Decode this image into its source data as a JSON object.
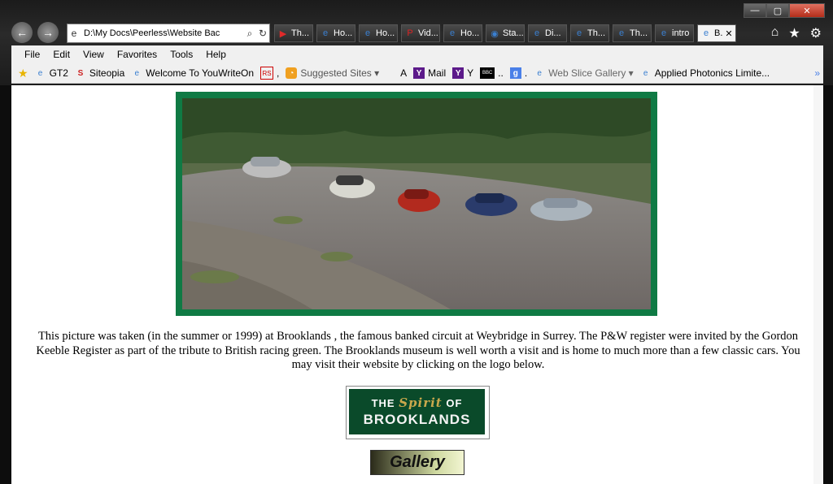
{
  "browser": {
    "address": "D:\\My Docs\\Peerless\\Website Bac",
    "tabs": [
      {
        "label": "Th...",
        "icon": "youtube-icon"
      },
      {
        "label": "Ho...",
        "icon": "ie-icon"
      },
      {
        "label": "Ho...",
        "icon": "ie-icon"
      },
      {
        "label": "Vid...",
        "icon": "p-icon"
      },
      {
        "label": "Ho...",
        "icon": "ie-icon"
      },
      {
        "label": "Sta...",
        "icon": "globe-icon"
      },
      {
        "label": "Di...",
        "icon": "ie-icon"
      },
      {
        "label": "Th...",
        "icon": "ie-icon"
      },
      {
        "label": "Th...",
        "icon": "ie-icon"
      },
      {
        "label": "intro",
        "icon": "ie-icon"
      },
      {
        "label": "B.",
        "icon": "ie-icon"
      }
    ],
    "menu": [
      "File",
      "Edit",
      "View",
      "Favorites",
      "Tools",
      "Help"
    ],
    "favorites": [
      {
        "label": "GT2",
        "icon": "ie-icon"
      },
      {
        "label": "Siteopia",
        "icon": "siteopia-icon"
      },
      {
        "label": "Welcome To YouWriteOn",
        "icon": "ie-icon"
      },
      {
        "label": ",",
        "icon": "rs-icon"
      },
      {
        "label": "Suggested Sites ▾",
        "icon": "suggested-sites-icon"
      },
      {
        "label": "A",
        "icon": "apple-icon"
      },
      {
        "label": "Mail",
        "icon": "yahoo-icon"
      },
      {
        "label": "Y",
        "icon": "yahoo-icon"
      },
      {
        "label": "..",
        "icon": "bbc-icon"
      },
      {
        "label": ".",
        "icon": "google-icon"
      },
      {
        "label": "Web Slice Gallery ▾",
        "icon": "web-slice-icon"
      },
      {
        "label": "Applied Photonics Limite...",
        "icon": "ie-icon"
      }
    ]
  },
  "page": {
    "caption": "This picture was taken (in the summer or 1999) at Brooklands , the famous banked circuit at Weybridge in Surrey. The P&W register were invited by the Gordon Keeble Register as part of the tribute to British racing green. The Brooklands museum is well worth a visit and is home to much more than a few classic cars. You may visit their website by clicking on the logo below.",
    "logo_line1_a": "THE",
    "logo_line1_b": "Spirit",
    "logo_line1_c": "OF",
    "logo_line2": "BROOKLANDS",
    "gallery_label": "Gallery"
  }
}
